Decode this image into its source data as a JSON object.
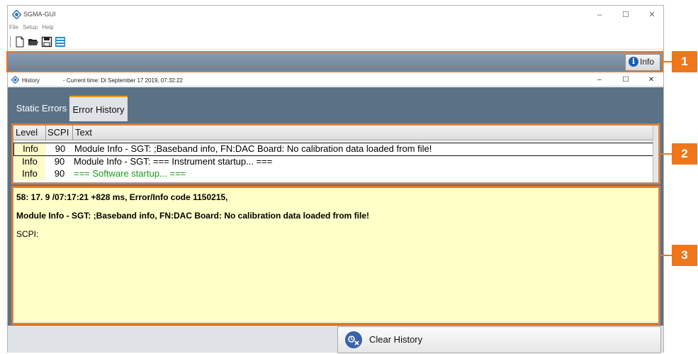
{
  "app": {
    "title": "SGMA-GUI",
    "menu": [
      "File",
      "Setup",
      "Help"
    ],
    "window_controls": [
      "–",
      "☐",
      "✕"
    ]
  },
  "toolbar": {
    "icons": [
      "new-file-icon",
      "open-folder-icon",
      "save-disk-icon",
      "layout-icon"
    ]
  },
  "info_bar": {
    "info_button_label": "Info"
  },
  "history_window": {
    "title": "History",
    "current_time": "- Current time: Di September 17 2019,   07:32:22",
    "window_controls": [
      "–",
      "☐",
      "✕"
    ],
    "tabs": [
      {
        "label": "Static Errors",
        "active": false
      },
      {
        "label": "Error History",
        "active": true
      }
    ],
    "table": {
      "columns": [
        "Level",
        "SCPI",
        "Text"
      ],
      "rows": [
        {
          "level": "Info",
          "scpi": "90",
          "text": "Module Info - SGT: ;Baseband info, FN:DAC Board: No calibration data loaded from file!",
          "selected": true,
          "color": "#000000"
        },
        {
          "level": "Info",
          "scpi": "90",
          "text": "Module Info - SGT: === Instrument startup... ===",
          "selected": false,
          "color": "#000000"
        },
        {
          "level": "Info",
          "scpi": "90",
          "text": "=== Software startup... ===",
          "selected": false,
          "color": "#1e9a1e"
        }
      ]
    },
    "detail": {
      "line1": "58: 17. 9 /07:17:21 +828 ms, Error/Info code 1150215,",
      "line2": "Module Info - SGT: ;Baseband info, FN:DAC Board: No calibration data loaded from file!",
      "line3": "SCPI:"
    },
    "clear_history_label": "Clear History"
  },
  "annotations": [
    "1",
    "2",
    "3"
  ],
  "colors": {
    "accent": "#f0761b",
    "panel": "#5b7186",
    "info_blue": "#1f5ea8",
    "detail_bg": "#ffffc8"
  }
}
